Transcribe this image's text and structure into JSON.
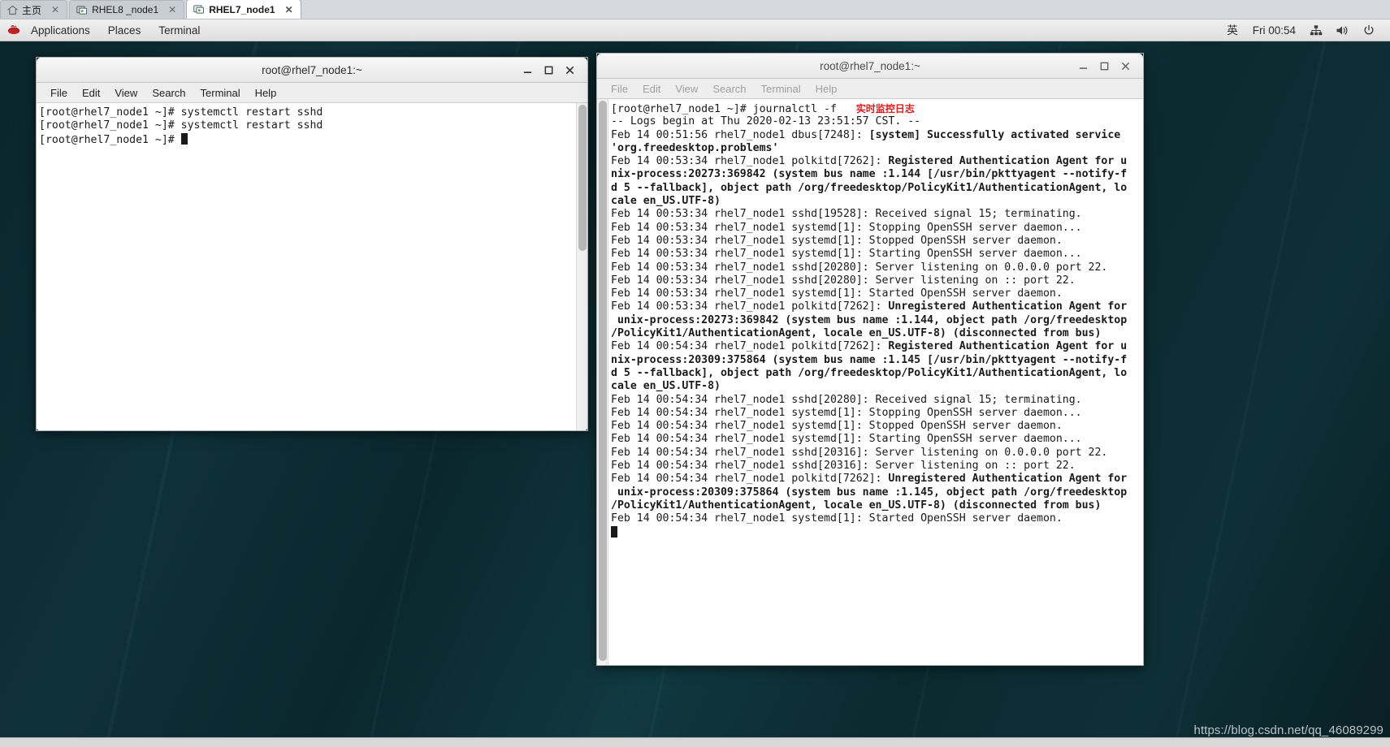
{
  "browser_tabs": [
    {
      "label": "主页",
      "icon": "home-icon",
      "close": "✕",
      "active": false
    },
    {
      "label": "RHEL8 _node1",
      "icon": "screen-play-icon",
      "close": "✕",
      "active": false
    },
    {
      "label": "RHEL7_node1",
      "icon": "screen-play-icon",
      "close": "✕",
      "active": true
    }
  ],
  "gnome_panel": {
    "logo": "redhat-logo-icon",
    "menus": [
      "Applications",
      "Places",
      "Terminal"
    ],
    "tray": {
      "input_method": "英",
      "clock": "Fri 00:54",
      "network_icon": "network-wired-icon",
      "volume_icon": "volume-icon",
      "power_icon": "power-icon"
    }
  },
  "window_left": {
    "title": "root@rhel7_node1:~",
    "menus": [
      "File",
      "Edit",
      "View",
      "Search",
      "Terminal",
      "Help"
    ],
    "buttons": {
      "minimize": "minimize-button",
      "maximize": "maximize-button",
      "close": "close-button"
    },
    "lines": [
      "[root@rhel7_node1 ~]# systemctl restart sshd",
      "[root@rhel7_node1 ~]# systemctl restart sshd",
      "[root@rhel7_node1 ~]# "
    ]
  },
  "window_right": {
    "title": "root@rhel7_node1:~",
    "menus": [
      "File",
      "Edit",
      "View",
      "Search",
      "Terminal",
      "Help"
    ],
    "buttons": {
      "minimize": "minimize-button",
      "maximize": "maximize-button",
      "close": "close-button"
    },
    "prompt": "[root@rhel7_node1 ~]# journalctl -f",
    "annotation": "实时监控日志",
    "lines": [
      {
        "text": "-- Logs begin at Thu 2020-02-13 23:51:57 CST. --",
        "bold": false
      },
      {
        "text": "Feb 14 00:51:56 rhel7_node1 dbus[7248]: ",
        "bold_tail": "[system] Successfully activated service"
      },
      {
        "text": "'org.freedesktop.problems'",
        "bold": true
      },
      {
        "text": "Feb 14 00:53:34 rhel7_node1 polkitd[7262]: ",
        "bold_tail": "Registered Authentication Agent for u"
      },
      {
        "text": "nix-process:20273:369842 (system bus name :1.144 [/usr/bin/pkttyagent --notify-f",
        "bold": true
      },
      {
        "text": "d 5 --fallback], object path /org/freedesktop/PolicyKit1/AuthenticationAgent, lo",
        "bold": true
      },
      {
        "text": "cale en_US.UTF-8)",
        "bold": true
      },
      {
        "text": "Feb 14 00:53:34 rhel7_node1 sshd[19528]: Received signal 15; terminating.",
        "bold": false
      },
      {
        "text": "Feb 14 00:53:34 rhel7_node1 systemd[1]: Stopping OpenSSH server daemon...",
        "bold": false
      },
      {
        "text": "Feb 14 00:53:34 rhel7_node1 systemd[1]: Stopped OpenSSH server daemon.",
        "bold": false
      },
      {
        "text": "Feb 14 00:53:34 rhel7_node1 systemd[1]: Starting OpenSSH server daemon...",
        "bold": false
      },
      {
        "text": "Feb 14 00:53:34 rhel7_node1 sshd[20280]: Server listening on 0.0.0.0 port 22.",
        "bold": false
      },
      {
        "text": "Feb 14 00:53:34 rhel7_node1 sshd[20280]: Server listening on :: port 22.",
        "bold": false
      },
      {
        "text": "Feb 14 00:53:34 rhel7_node1 systemd[1]: Started OpenSSH server daemon.",
        "bold": false
      },
      {
        "text": "Feb 14 00:53:34 rhel7_node1 polkitd[7262]: ",
        "bold_tail": "Unregistered Authentication Agent for"
      },
      {
        "text": " unix-process:20273:369842 (system bus name :1.144, object path /org/freedesktop",
        "bold": true
      },
      {
        "text": "/PolicyKit1/AuthenticationAgent, locale en_US.UTF-8) (disconnected from bus)",
        "bold": true
      },
      {
        "text": "Feb 14 00:54:34 rhel7_node1 polkitd[7262]: ",
        "bold_tail": "Registered Authentication Agent for u"
      },
      {
        "text": "nix-process:20309:375864 (system bus name :1.145 [/usr/bin/pkttyagent --notify-f",
        "bold": true
      },
      {
        "text": "d 5 --fallback], object path /org/freedesktop/PolicyKit1/AuthenticationAgent, lo",
        "bold": true
      },
      {
        "text": "cale en_US.UTF-8)",
        "bold": true
      },
      {
        "text": "Feb 14 00:54:34 rhel7_node1 sshd[20280]: Received signal 15; terminating.",
        "bold": false
      },
      {
        "text": "Feb 14 00:54:34 rhel7_node1 systemd[1]: Stopping OpenSSH server daemon...",
        "bold": false
      },
      {
        "text": "Feb 14 00:54:34 rhel7_node1 systemd[1]: Stopped OpenSSH server daemon.",
        "bold": false
      },
      {
        "text": "Feb 14 00:54:34 rhel7_node1 systemd[1]: Starting OpenSSH server daemon...",
        "bold": false
      },
      {
        "text": "Feb 14 00:54:34 rhel7_node1 sshd[20316]: Server listening on 0.0.0.0 port 22.",
        "bold": false
      },
      {
        "text": "Feb 14 00:54:34 rhel7_node1 sshd[20316]: Server listening on :: port 22.",
        "bold": false
      },
      {
        "text": "Feb 14 00:54:34 rhel7_node1 polkitd[7262]: ",
        "bold_tail": "Unregistered Authentication Agent for"
      },
      {
        "text": " unix-process:20309:375864 (system bus name :1.145, object path /org/freedesktop",
        "bold": true
      },
      {
        "text": "/PolicyKit1/AuthenticationAgent, locale en_US.UTF-8) (disconnected from bus)",
        "bold": true
      },
      {
        "text": "Feb 14 00:54:34 rhel7_node1 systemd[1]: Started OpenSSH server daemon.",
        "bold": false
      }
    ]
  },
  "watermark": "https://blog.csdn.net/qq_46089299",
  "colors": {
    "desktop": "#0c2a2f",
    "panel": "#e9e9e9",
    "annotation_red": "#e01b1b",
    "terminal_bg": "#ffffff",
    "terminal_fg": "#1a1a1a"
  }
}
